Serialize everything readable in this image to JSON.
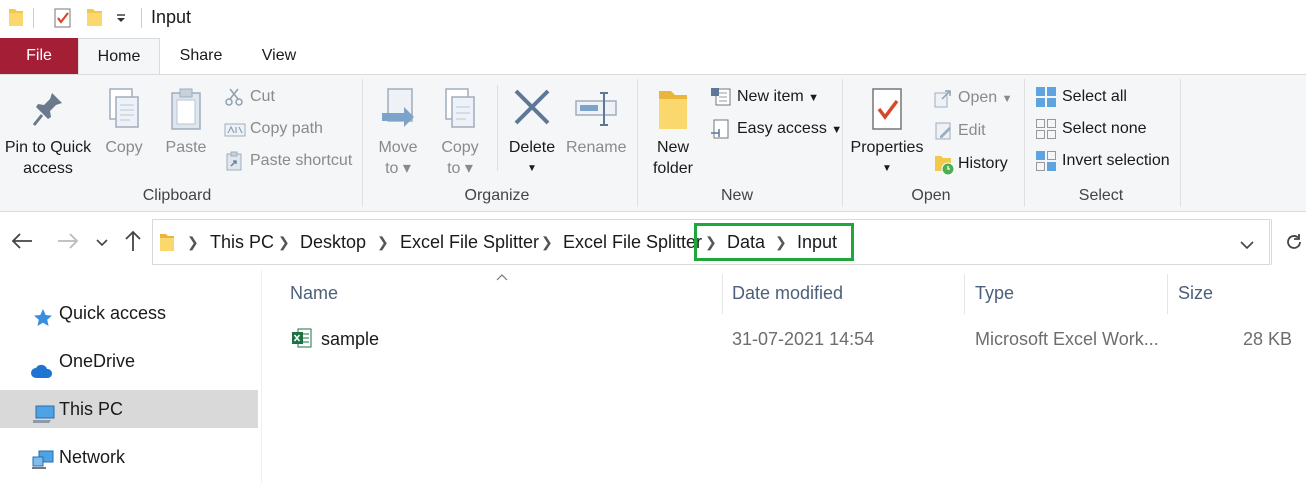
{
  "window": {
    "title": "Input"
  },
  "tabs": {
    "file": "File",
    "home": "Home",
    "share": "Share",
    "view": "View"
  },
  "ribbon": {
    "clipboard": {
      "pin_line1": "Pin to Quick",
      "pin_line2": "access",
      "copy": "Copy",
      "paste": "Paste",
      "cut": "Cut",
      "copy_path": "Copy path",
      "paste_shortcut": "Paste shortcut",
      "label": "Clipboard"
    },
    "organize": {
      "move_line1": "Move",
      "move_line2": "to",
      "copy_line1": "Copy",
      "copy_line2": "to",
      "delete": "Delete",
      "rename": "Rename",
      "label": "Organize"
    },
    "new": {
      "folder_line1": "New",
      "folder_line2": "folder",
      "new_item": "New item",
      "easy_access": "Easy access",
      "label": "New"
    },
    "open": {
      "properties": "Properties",
      "open": "Open",
      "edit": "Edit",
      "history": "History",
      "label": "Open"
    },
    "select": {
      "select_all": "Select all",
      "select_none": "Select none",
      "invert": "Invert selection",
      "label": "Select"
    }
  },
  "breadcrumb": [
    "This PC",
    "Desktop",
    "Excel File Splitter",
    "Excel File Splitter",
    "Data",
    "Input"
  ],
  "highlight_color": "#1ea83c",
  "nav": {
    "quick_access": "Quick access",
    "onedrive": "OneDrive",
    "this_pc": "This PC",
    "network": "Network"
  },
  "columns": {
    "name": "Name",
    "date": "Date modified",
    "type": "Type",
    "size": "Size"
  },
  "files": [
    {
      "name": "sample",
      "date": "31-07-2021 14:54",
      "type": "Microsoft Excel Work...",
      "size": "28 KB"
    }
  ]
}
